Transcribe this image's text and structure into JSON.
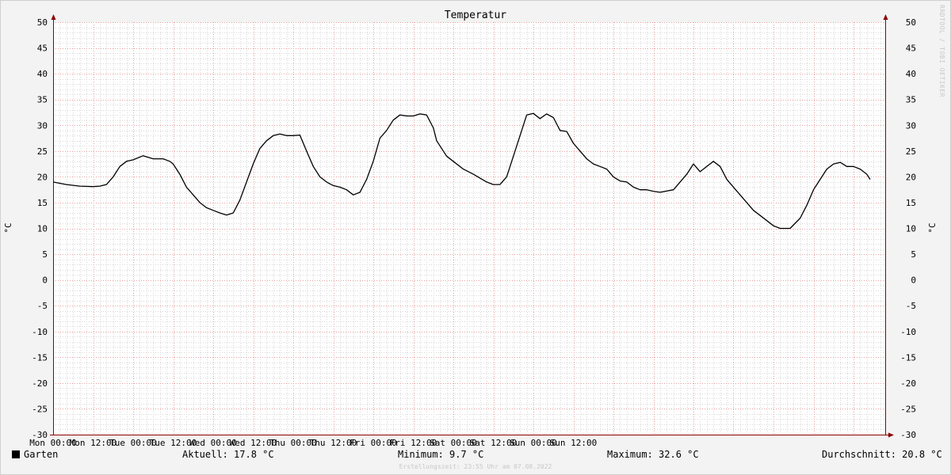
{
  "chart_data": {
    "type": "line",
    "title": "Temperatur",
    "ylabel_left": "°C",
    "ylabel_right": "°C",
    "ylim": [
      -30,
      50
    ],
    "yticks": [
      50,
      45,
      40,
      35,
      30,
      25,
      20,
      15,
      10,
      5,
      0,
      -5,
      -10,
      -15,
      -20,
      -25,
      -30
    ],
    "xticks": [
      "Mon 00:00",
      "Mon 12:00",
      "Tue 00:00",
      "Tue 12:00",
      "Wed 00:00",
      "Wed 12:00",
      "Thu 00:00",
      "Thu 12:00",
      "Fri 00:00",
      "Fri 12:00",
      "Sat 00:00",
      "Sat 12:00",
      "Sun 00:00",
      "Sun 12:00"
    ],
    "x_unit": "hours since Mon 00:00",
    "grid": true,
    "colors": {
      "background": "#f3f3f3",
      "plot_background": "#ffffff",
      "line": "#000000",
      "grid_major": "#e8a0a0",
      "grid_minor": "#d8d8d8",
      "axis": "#8b0000"
    },
    "series": [
      {
        "name": "Garten",
        "x": [
          0,
          4,
          8,
          12,
          14,
          16,
          18,
          20,
          22,
          24,
          27,
          30,
          33,
          35,
          36,
          38,
          40,
          42,
          44,
          46,
          48,
          50,
          52,
          54,
          56,
          58,
          60,
          61,
          62,
          64,
          66,
          68,
          70,
          72,
          74,
          76,
          78,
          80,
          82,
          84,
          86,
          88,
          90,
          92,
          94,
          96,
          98,
          100,
          102,
          104,
          106,
          108,
          110,
          112,
          114,
          115,
          117,
          118,
          120,
          123,
          126,
          130,
          132,
          134,
          136,
          138,
          140,
          142,
          144,
          146,
          148,
          150,
          152,
          154,
          156,
          158,
          160,
          162,
          164,
          166,
          168,
          170,
          172,
          174,
          176,
          178,
          180,
          182,
          186,
          190,
          192,
          194,
          196,
          198,
          200,
          202,
          204,
          206,
          208,
          210,
          212,
          214,
          216,
          218,
          221,
          224,
          226,
          228,
          230,
          232,
          234,
          236,
          238,
          240,
          242,
          244,
          245
        ],
        "values": [
          19,
          18.5,
          18.2,
          18.1,
          18.2,
          18.5,
          20,
          22,
          23,
          23.3,
          24.1,
          23.5,
          23.5,
          23,
          22.5,
          20.5,
          18,
          16.5,
          15,
          14,
          13.5,
          13,
          12.6,
          13,
          15.5,
          19,
          22.5,
          24,
          25.5,
          27,
          28,
          28.3,
          28,
          28,
          28.1,
          25,
          22,
          20,
          19,
          18.3,
          18,
          17.5,
          16.5,
          17,
          19.5,
          23,
          27.5,
          29,
          31,
          32,
          31.8,
          31.8,
          32.2,
          32,
          29.5,
          27,
          25,
          24,
          23,
          21.5,
          20.5,
          19,
          18.5,
          18.5,
          20,
          24,
          28,
          32,
          32.3,
          31.3,
          32.2,
          31.5,
          29,
          28.8,
          26.5,
          25,
          23.5,
          22.5,
          22,
          21.5,
          20,
          19.2,
          19,
          18,
          17.5,
          17.5,
          17.2,
          17,
          17.5,
          20.5,
          22.5,
          21,
          22,
          23,
          22,
          19.5,
          18,
          16.5,
          15,
          13.5,
          12.5,
          11.5,
          10.5,
          10,
          10,
          12,
          14.5,
          17.5,
          19.5,
          21.5,
          22.5,
          22.8,
          22,
          22,
          21.5,
          20.5,
          19.5
        ]
      }
    ]
  },
  "legend": {
    "series_name": "Garten",
    "aktuell": "Aktuell: 17.8 °C",
    "minimum": "Minimum: 9.7 °C",
    "maximum": "Maximum: 32.6 °C",
    "durchschnitt": "Durchschnitt: 20.8 °C"
  },
  "footer": "Erstellungszeit: 23:55 Uhr am 07.08.2022",
  "watermark": "RRDTOOL / TOBI OETIKER"
}
